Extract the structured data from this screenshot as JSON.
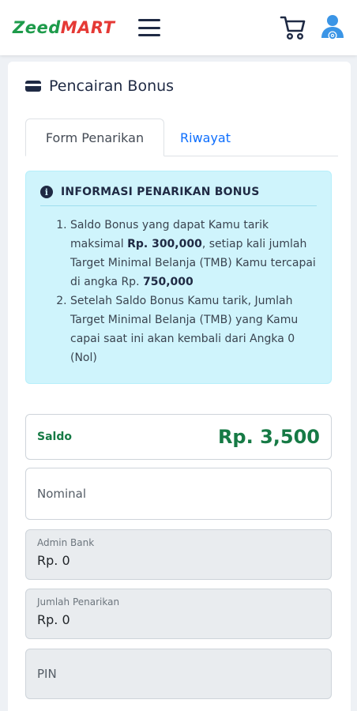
{
  "header": {
    "logo_part1": "Zeed",
    "logo_part2": "MART",
    "icons": [
      "menu-icon",
      "cart-icon",
      "user-settings-icon"
    ]
  },
  "colors": {
    "brand_green": "#1e9b4b",
    "brand_red": "#e53935",
    "info_bg": "#cff4fc",
    "link_blue": "#0d6efd",
    "saldo_green": "#167a45"
  },
  "page": {
    "title": "Pencairan Bonus"
  },
  "tabs": [
    {
      "label": "Form Penarikan",
      "active": true
    },
    {
      "label": "Riwayat",
      "active": false
    }
  ],
  "info": {
    "title": "INFORMASI PENARIKAN BONUS",
    "item1_a": "Saldo Bonus yang dapat Kamu tarik maksimal ",
    "item1_b": "Rp. 300,000",
    "item1_c": ", setiap kali jumlah Target Minimal Belanja (TMB) Kamu tercapai di angka Rp. ",
    "item1_d": "750,000",
    "item2": "Setelah Saldo Bonus Kamu tarik, Jumlah Target Minimal Belanja (TMB) yang Kamu capai saat ini akan kembali dari Angka 0 (Nol)"
  },
  "form": {
    "saldo_label": "Saldo",
    "saldo_value": "Rp. 3,500",
    "nominal_placeholder": "Nominal",
    "admin_label": "Admin Bank",
    "admin_value": "Rp. 0",
    "jumlah_label": "Jumlah Penarikan",
    "jumlah_value": "Rp. 0",
    "pin_placeholder": "PIN"
  }
}
